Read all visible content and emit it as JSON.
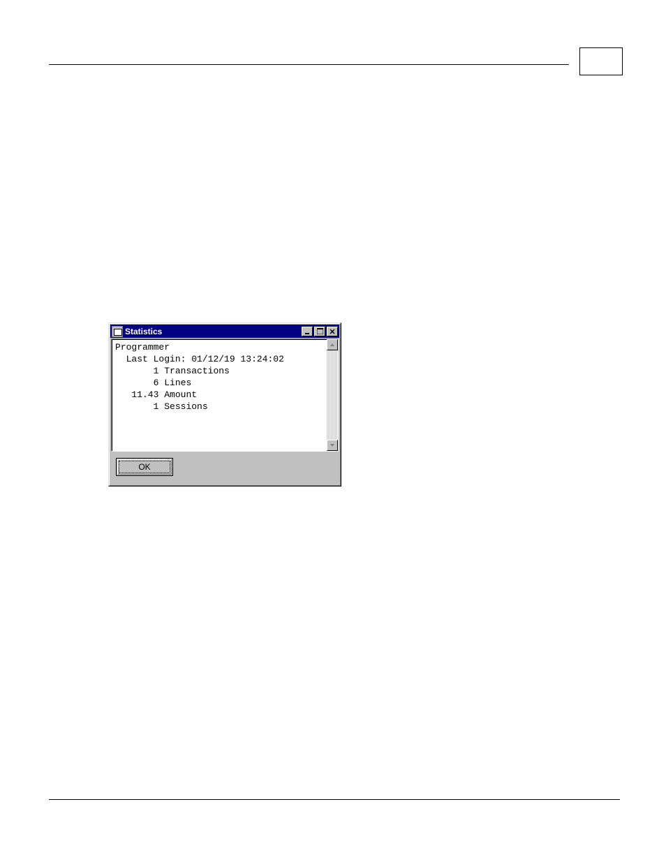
{
  "window": {
    "title": "Statistics",
    "ok_label": "OK",
    "content": {
      "user": "Programmer",
      "last_login_label": "Last Login:",
      "last_login_value": "01/12/19 13:24:02",
      "stats": [
        {
          "value": "1",
          "label": "Transactions"
        },
        {
          "value": "6",
          "label": "Lines"
        },
        {
          "value": "11.43",
          "label": "Amount"
        },
        {
          "value": "1",
          "label": "Sessions"
        }
      ]
    }
  }
}
